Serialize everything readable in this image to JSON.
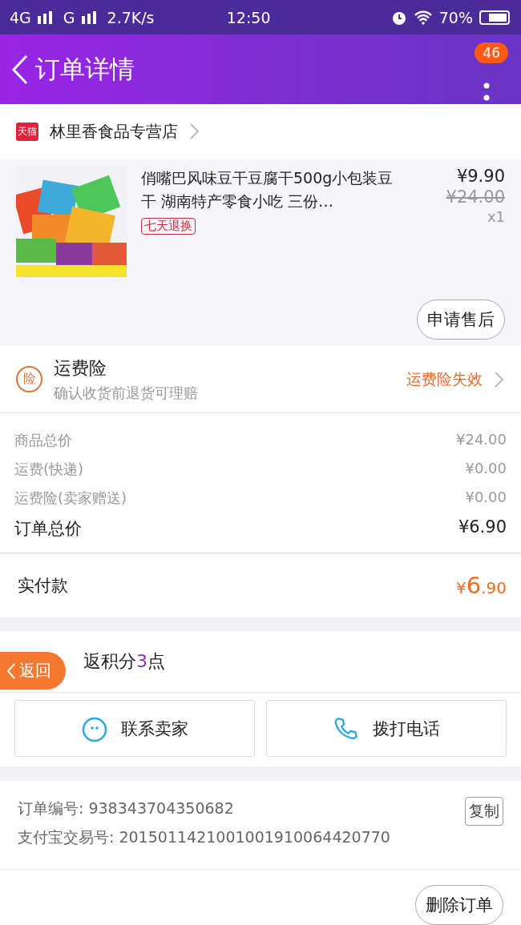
{
  "status_bar": {
    "network_1": "4G",
    "network_2": "G",
    "speed": "2.7K/s",
    "time": "12:50",
    "battery": "70%"
  },
  "header": {
    "title": "订单详情",
    "badge": "46"
  },
  "store": {
    "name": "林里香食品专营店",
    "badge": "天猫"
  },
  "product": {
    "title": "俏嘴巴风味豆干豆腐干500g小包装豆干 湖南特产零食小吃 三份…",
    "tag": "七天退换",
    "price": "¥9.90",
    "original_price": "¥24.00",
    "quantity": "x1",
    "action": "申请售后"
  },
  "insurance": {
    "icon_text": "险",
    "title": "运费险",
    "subtitle": "确认收货前退货可理赔",
    "status": "运费险失效"
  },
  "price_lines": [
    {
      "label": "商品总价",
      "value": "¥24.00",
      "kind": "minor"
    },
    {
      "label": "运费(快递)",
      "value": "¥0.00",
      "kind": "minor"
    },
    {
      "label": "运费险(卖家赠送)",
      "value": "¥0.00",
      "kind": "minor"
    },
    {
      "label": "订单总价",
      "value": "¥6.90",
      "kind": "total"
    }
  ],
  "paid": {
    "label": "实付款",
    "currency": "¥",
    "amount": "6",
    "cents": ".90"
  },
  "points": {
    "prefix": "返积分",
    "amount": "3",
    "suffix": "点"
  },
  "contact_buttons": [
    {
      "label": "联系卖家",
      "kind": "chat"
    },
    {
      "label": "拨打电话",
      "kind": "phone"
    }
  ],
  "order_info": {
    "lines": [
      "订单编号: 938343704350682",
      "支付宝交易号: 2015011421001001910064420770"
    ],
    "copy": "复制"
  },
  "back_float": "返回",
  "bottom_action": "删除订单"
}
